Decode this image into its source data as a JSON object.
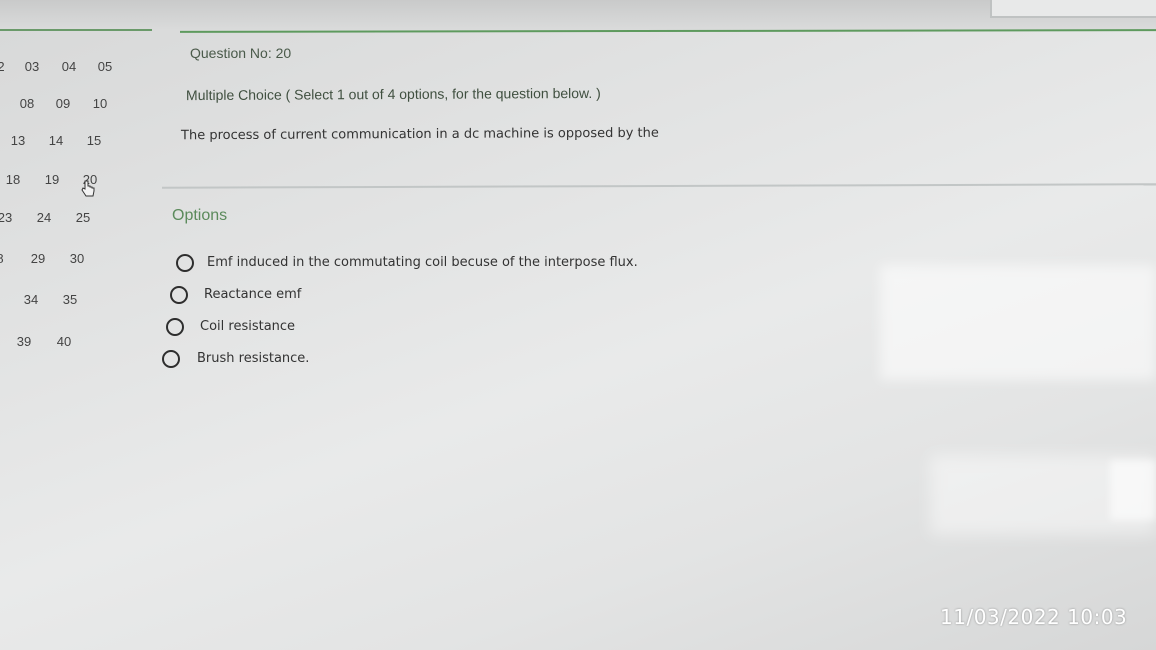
{
  "question_palette": [
    {
      "number": "2"
    },
    {
      "number": "03"
    },
    {
      "number": "04"
    },
    {
      "number": "05"
    },
    {
      "number": "08"
    },
    {
      "number": "09"
    },
    {
      "number": "10"
    },
    {
      "number": "13"
    },
    {
      "number": "14"
    },
    {
      "number": "15"
    },
    {
      "number": "18"
    },
    {
      "number": "19"
    },
    {
      "number": "20"
    },
    {
      "number": "23"
    },
    {
      "number": "24"
    },
    {
      "number": "25"
    },
    {
      "number": "8"
    },
    {
      "number": "29"
    },
    {
      "number": "30"
    },
    {
      "number": "34"
    },
    {
      "number": "35"
    },
    {
      "number": "39"
    },
    {
      "number": "40"
    }
  ],
  "current_question": "20",
  "question": {
    "number_label": "Question No: 20",
    "type_label": "Multiple Choice ( Select 1 out of 4 options, for the question below. )",
    "text": "The process of current communication in a dc machine is opposed by the"
  },
  "options_heading": "Options",
  "options": [
    {
      "label": "Emf induced in the commutating coil becuse of the interpose flux."
    },
    {
      "label": "Reactance emf"
    },
    {
      "label": "Coil resistance"
    },
    {
      "label": "Brush resistance."
    }
  ],
  "photo_timestamp": "11/03/2022 10:03",
  "icons": {
    "pointer": "hand-pointer-icon",
    "radio": "radio-button-icon"
  }
}
